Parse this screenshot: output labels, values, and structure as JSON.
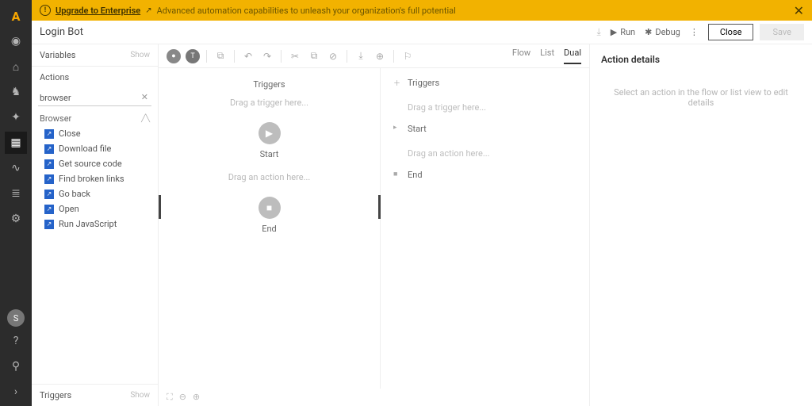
{
  "banner": {
    "link": "Upgrade to Enterprise",
    "subtext": "Advanced automation capabilities to unleash your organization's full potential"
  },
  "header": {
    "title": "Login Bot",
    "run": "Run",
    "debug": "Debug",
    "close": "Close",
    "save": "Save"
  },
  "side": {
    "variables": "Variables",
    "actions": "Actions",
    "show": "Show",
    "search_value": "browser",
    "group": "Browser",
    "items": [
      "Close",
      "Download file",
      "Get source code",
      "Find broken links",
      "Go back",
      "Open",
      "Run JavaScript"
    ],
    "triggers": "Triggers"
  },
  "toolbar": {
    "tabs": {
      "flow": "Flow",
      "list": "List",
      "dual": "Dual"
    }
  },
  "flow": {
    "triggers": "Triggers",
    "drag_trigger": "Drag a trigger here...",
    "start": "Start",
    "drag_action": "Drag an action here...",
    "end": "End"
  },
  "list": {
    "triggers": "Triggers",
    "drag_trigger": "Drag a trigger here...",
    "start": "Start",
    "drag_action": "Drag an action here...",
    "end": "End"
  },
  "details": {
    "heading": "Action details",
    "hint": "Select an action in the flow or list view to edit details"
  },
  "rail_avatar": "S"
}
